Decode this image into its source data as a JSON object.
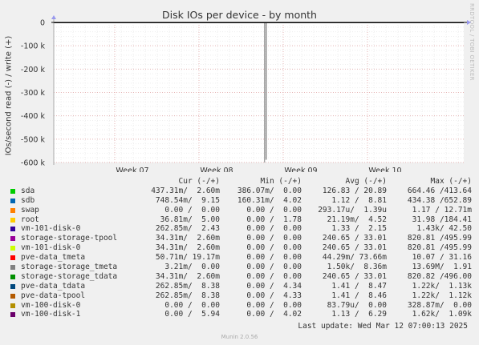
{
  "title": "Disk IOs per device - by month",
  "ylabel": "IOs/second read (-) / write (+)",
  "watermark": "RRDTOOL / TOBI OETIKER",
  "footer": "Munin 2.0.56",
  "last_update": "Last update: Wed Mar 12 07:00:13 2025",
  "legend_headers": [
    "Cur (-/+)",
    "Min (-/+)",
    "Avg (-/+)",
    "Max (-/+)"
  ],
  "chart_data": {
    "type": "line",
    "title": "Disk IOs per device - by month",
    "ylabel": "IOs/second read (-) / write (+)",
    "ylim": [
      -600000,
      0
    ],
    "yticks": [
      0,
      -100000,
      -200000,
      -300000,
      -400000,
      -500000,
      -600000
    ],
    "ytick_labels": [
      "0",
      "-100 k",
      "-200 k",
      "-300 k",
      "-400 k",
      "-500 k",
      "-600 k"
    ],
    "xtick_labels": [
      "Week 07",
      "Week 08",
      "Week 09",
      "Week 10"
    ],
    "grid": true,
    "spike": {
      "week_position": 1.95,
      "value": -600000
    },
    "series": [
      {
        "name": "sda",
        "color": "#00cc00",
        "cur": "437.31m/  2.60m",
        "min": "386.07m/  0.00",
        "avg": "126.83 / 20.89",
        "max": "664.46 /413.64"
      },
      {
        "name": "sdb",
        "color": "#0066b3",
        "cur": "748.54m/  9.15",
        "min": "160.31m/  4.02",
        "avg": "1.12 /  8.81",
        "max": "434.38 /652.89"
      },
      {
        "name": "swap",
        "color": "#ff8000",
        "cur": "0.00 /  0.00",
        "min": "0.00 /  0.00",
        "avg": "293.17u/  1.39u",
        "max": "1.17 / 12.71m"
      },
      {
        "name": "root",
        "color": "#ffcc00",
        "cur": "36.81m/  5.00",
        "min": "0.00 /  1.78",
        "avg": "21.19m/  4.52",
        "max": "31.98 /184.41"
      },
      {
        "name": "vm-101-disk-0",
        "color": "#330099",
        "cur": "262.85m/  2.43",
        "min": "0.00 /  0.00",
        "avg": "1.33 /  2.15",
        "max": "1.43k/ 42.50"
      },
      {
        "name": "storage-storage-tpool",
        "color": "#990099",
        "cur": "34.31m/  2.60m",
        "min": "0.00 /  0.00",
        "avg": "240.65 / 33.01",
        "max": "820.81 /495.99"
      },
      {
        "name": "vm-101-disk-0",
        "color": "#ccff00",
        "cur": "34.31m/  2.60m",
        "min": "0.00 /  0.00",
        "avg": "240.65 / 33.01",
        "max": "820.81 /495.99"
      },
      {
        "name": "pve-data_tmeta",
        "color": "#ff0000",
        "cur": "50.71m/ 19.17m",
        "min": "0.00 /  0.00",
        "avg": "44.29m/ 73.66m",
        "max": "10.07 / 31.16"
      },
      {
        "name": "storage-storage_tmeta",
        "color": "#808080",
        "cur": "3.21m/  0.00",
        "min": "0.00 /  0.00",
        "avg": "1.50k/  8.36m",
        "max": "13.69M/  1.91"
      },
      {
        "name": "storage-storage_tdata",
        "color": "#008f00",
        "cur": "34.31m/  2.60m",
        "min": "0.00 /  0.00",
        "avg": "240.65 / 33.01",
        "max": "820.82 /496.00"
      },
      {
        "name": "pve-data_tdata",
        "color": "#00487d",
        "cur": "262.85m/  8.38",
        "min": "0.00 /  4.34",
        "avg": "1.41 /  8.47",
        "max": "1.22k/  1.13k"
      },
      {
        "name": "pve-data-tpool",
        "color": "#b35a00",
        "cur": "262.85m/  8.38",
        "min": "0.00 /  4.33",
        "avg": "1.41 /  8.46",
        "max": "1.22k/  1.12k"
      },
      {
        "name": "vm-100-disk-0",
        "color": "#b38f00",
        "cur": "0.00 /  0.00",
        "min": "0.00 /  0.00",
        "avg": "83.79u/  0.00",
        "max": "328.87m/  0.00"
      },
      {
        "name": "vm-100-disk-1",
        "color": "#6b006b",
        "cur": "0.00 /  5.94",
        "min": "0.00 /  4.02",
        "avg": "1.13 /  6.29",
        "max": "1.62k/  1.09k"
      }
    ]
  }
}
